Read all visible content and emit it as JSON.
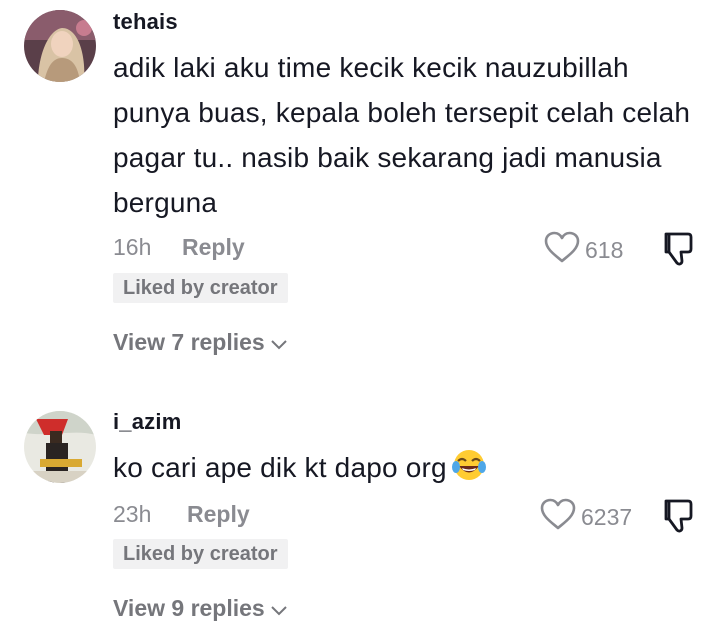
{
  "comments": [
    {
      "username": "tehais",
      "text": "adik laki aku time kecik kecik nauzubillah punya buas, kepala boleh tersepit celah celah pagar tu.. nasib baik sekarang jadi manusia berguna",
      "time": "16h",
      "reply_label": "Reply",
      "likes": "618",
      "creator_badge": "Liked by creator",
      "view_replies": "View 7 replies",
      "avatar_icon": "profile-avatar",
      "like_icon": "heart-outline-icon",
      "dislike_icon": "thumbs-down-icon"
    },
    {
      "username": "i_azim",
      "text": "ko cari ape dik kt dapo org",
      "emoji": "face-with-tears-of-joy",
      "time": "23h",
      "reply_label": "Reply",
      "likes": "6237",
      "creator_badge": "Liked by creator",
      "view_replies": "View 9 replies",
      "avatar_icon": "profile-avatar",
      "like_icon": "heart-outline-icon",
      "dislike_icon": "thumbs-down-icon"
    }
  ],
  "colors": {
    "text_primary": "#161823",
    "text_secondary": "#8a8b91",
    "badge_bg": "#f1f1f2",
    "background": "#ffffff"
  }
}
